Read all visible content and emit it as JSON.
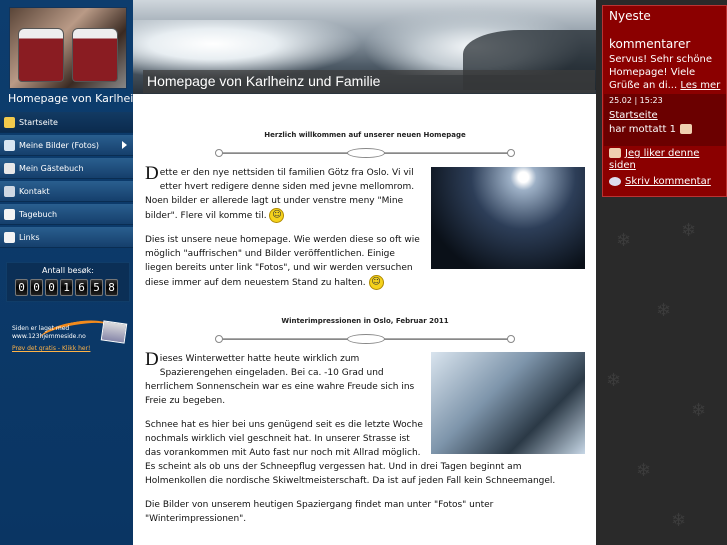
{
  "sidebar": {
    "site_name": "Homepage von Karlheinz und Familie",
    "menu": [
      {
        "label": "Startseite"
      },
      {
        "label": "Meine Bilder (Fotos)"
      },
      {
        "label": "Mein Gästebuch"
      },
      {
        "label": "Kontakt"
      },
      {
        "label": "Tagebuch"
      },
      {
        "label": "Links"
      }
    ],
    "counter_label": "Antall besøk:",
    "counter_digits": [
      "0",
      "0",
      "0",
      "1",
      "6",
      "5",
      "8"
    ],
    "made_with": "Siden er laget med",
    "made_site": "www.123hjemmeside.no",
    "made_link": "Prøv det gratis - Klikk her!"
  },
  "header": {
    "title": "Homepage von Karlheinz und Familie"
  },
  "content": {
    "section1_title": "Herzlich willkommen auf unserer neuen Homepage",
    "p1_drop": "D",
    "p1_text": "ette er den nye nettsiden til familien Götz fra Oslo. Vi vil etter hvert redigere denne siden med jevne mellomrom. Noen bilder er allerede lagt ut under venstre meny \"Mine bilder\". Flere vil komme til.",
    "p2_text": "Dies ist unsere neue homepage. Wie werden diese so oft wie möglich \"auffrischen\" und Bilder veröffentlichen. Einige liegen bereits unter link \"Fotos\", und wir werden versuchen diese immer auf dem neuestem Stand zu halten.",
    "section2_title": "Winterimpressionen in Oslo, Februar 2011",
    "p3_drop": "D",
    "p3_text": "ieses Winterwetter hatte heute wirklich zum Spazierengehen eingeladen. Bei ca. -10 Grad und herrlichem Sonnenschein war es eine wahre Freude sich ins Freie zu begeben.",
    "p4_text": "Schnee hat es hier bei uns genügend seit es die letzte Woche nochmals wirklich viel geschneit hat. In unserer Strasse ist das vorankommen mit Auto fast nur noch mit Allrad möglich. Es scheint als ob uns der Schneepflug vergessen hat.  Und in drei Tagen beginnt am Holmenkollen die nordische Skiweltmeisterschaft. Da ist auf jeden Fall kein Schneemangel.",
    "p5_text": "Die Bilder von unserem heutigen Spaziergang findet man unter \"Fotos\" unter \"Winterimpressionen\"."
  },
  "comments": {
    "heading": "Nyeste",
    "subheading": "kommentarer",
    "text": "Servus! Sehr schöne Homepage! Viele Grüße an di...",
    "more": "Les mer",
    "date": "25.02 | 15:23",
    "link": "Startseite",
    "got": "har mottatt 1",
    "like": "Jeg liker denne siden",
    "write": "Skriv kommentar"
  },
  "colors": {
    "sidebar": "#0d3d6e",
    "comments_bg": "#8b0000",
    "accent_link": "#ffb347"
  }
}
